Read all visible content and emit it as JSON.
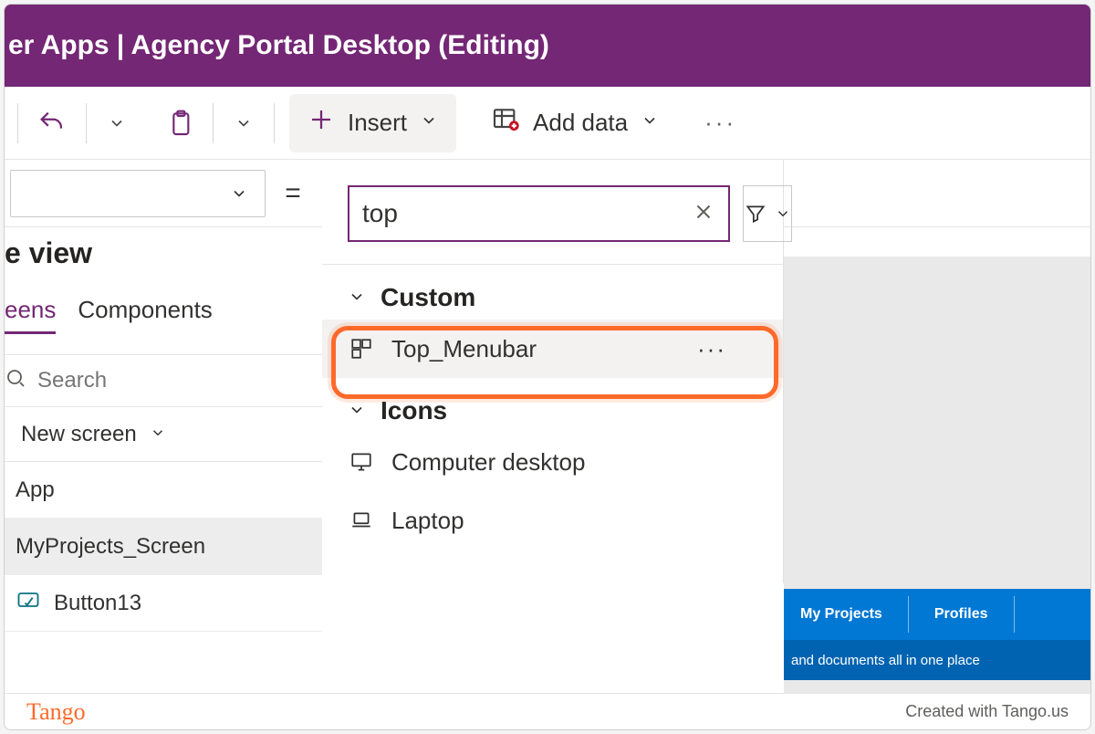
{
  "titlebar": {
    "text": "er Apps  |  Agency Portal Desktop (Editing)"
  },
  "toolbar": {
    "insert_label": "Insert",
    "add_data_label": "Add data"
  },
  "formula": {
    "equals": "="
  },
  "sidebar": {
    "title": "e view",
    "tabs": {
      "screens": "eens",
      "components": "Components"
    },
    "search_placeholder": "Search",
    "new_screen": "New screen",
    "tree": {
      "app": "App",
      "selected": "MyProjects_Screen",
      "child": "Button13"
    }
  },
  "insert_panel": {
    "search_value": "top",
    "groups": [
      {
        "label": "Custom",
        "items": [
          {
            "label": "Top_Menubar",
            "selected": true
          }
        ]
      },
      {
        "label": "Icons",
        "items": [
          {
            "label": "Computer desktop"
          },
          {
            "label": "Laptop"
          }
        ]
      }
    ]
  },
  "canvas_preview": {
    "tabs": [
      "My Projects",
      "Profiles"
    ],
    "strip": "and documents all in one place"
  },
  "footer": {
    "logo": "Tango",
    "credit": "Created with Tango.us"
  }
}
